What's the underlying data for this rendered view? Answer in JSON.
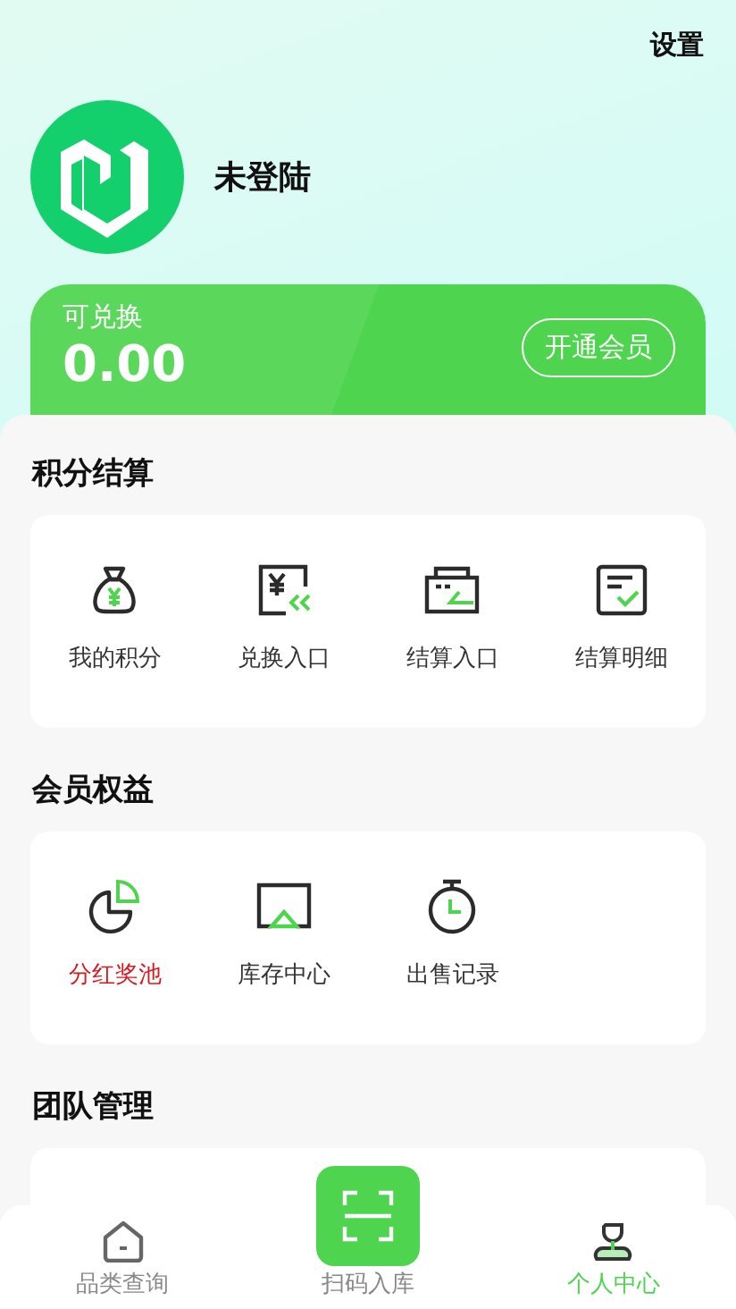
{
  "header": {
    "settings": "设置",
    "username": "未登陆"
  },
  "points_card": {
    "label": "可兑换",
    "value": "0.00",
    "button": "开通会员"
  },
  "sections": [
    {
      "title": "积分结算",
      "items": [
        {
          "label": "我的积分",
          "highlight": false
        },
        {
          "label": "兑换入口",
          "highlight": false
        },
        {
          "label": "结算入口",
          "highlight": false
        },
        {
          "label": "结算明细",
          "highlight": false
        }
      ]
    },
    {
      "title": "会员权益",
      "items": [
        {
          "label": "分红奖池",
          "highlight": true
        },
        {
          "label": "库存中心",
          "highlight": false
        },
        {
          "label": "出售记录",
          "highlight": false
        }
      ]
    },
    {
      "title": "团队管理"
    }
  ],
  "tab_bar": [
    {
      "label": "品类查询",
      "kind": "normal",
      "selected": false
    },
    {
      "label": "扫码入库",
      "kind": "scan",
      "selected": false
    },
    {
      "label": "个人中心",
      "kind": "normal",
      "selected": true
    }
  ]
}
